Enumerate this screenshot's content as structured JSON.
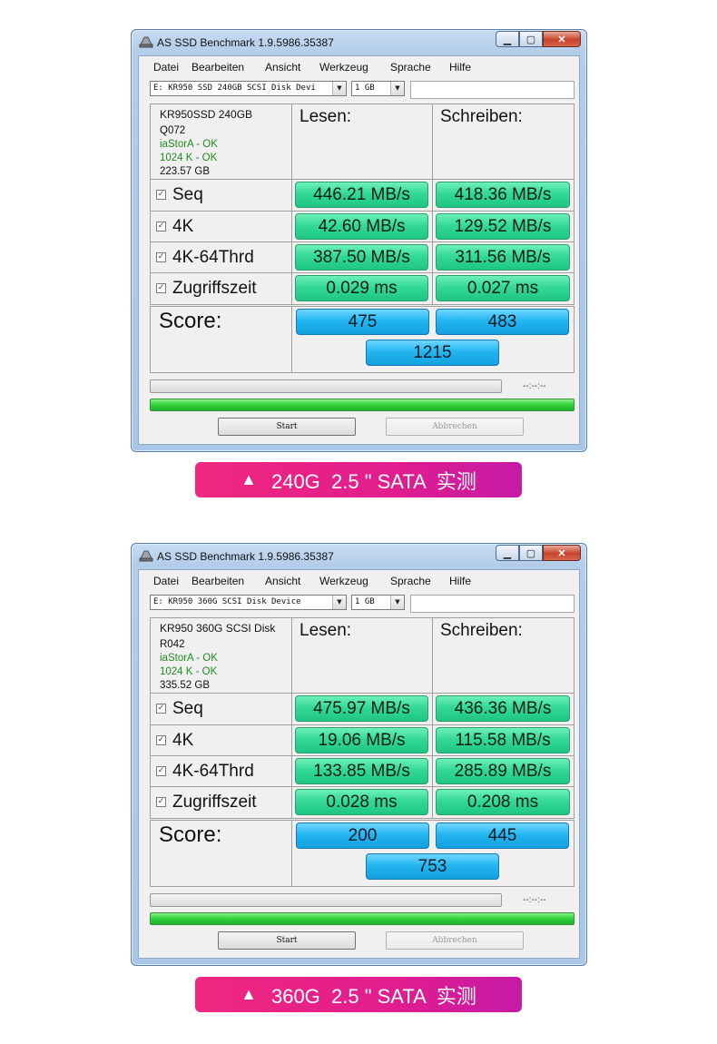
{
  "windows": [
    {
      "title": "AS SSD Benchmark 1.9.5986.35387",
      "menu": [
        "Datei",
        "Bearbeiten",
        "Ansicht",
        "Werkzeug",
        "Sprache",
        "Hilfe"
      ],
      "drive_select": "E: KR950 SSD 240GB SCSI Disk Devi",
      "size_select": "1 GB",
      "drive_info": {
        "model": "KR950SSD 240GB",
        "firmware": "Q072",
        "driver_status": "iaStorA - OK",
        "alignment_status": "1024 K - OK",
        "capacity": "223.57 GB"
      },
      "col_read": "Lesen:",
      "col_write": "Schreiben:",
      "rows": [
        {
          "label": "Seq",
          "checked": true,
          "read": "446.21 MB/s",
          "write": "418.36 MB/s"
        },
        {
          "label": "4K",
          "checked": true,
          "read": "42.60 MB/s",
          "write": "129.52 MB/s"
        },
        {
          "label": "4K-64Thrd",
          "checked": true,
          "read": "387.50 MB/s",
          "write": "311.56 MB/s"
        },
        {
          "label": "Zugriffszeit",
          "checked": true,
          "read": "0.029 ms",
          "write": "0.027 ms"
        }
      ],
      "score_label": "Score:",
      "score_read": "475",
      "score_write": "483",
      "score_total": "1215",
      "timer": "--:--:--",
      "progress_fraction": 0.0,
      "overall_progress_fraction": 1.0,
      "start_label": "Start",
      "abort_label": "Abbrechen"
    },
    {
      "title": "AS SSD Benchmark 1.9.5986.35387",
      "menu": [
        "Datei",
        "Bearbeiten",
        "Ansicht",
        "Werkzeug",
        "Sprache",
        "Hilfe"
      ],
      "drive_select": "E: KR950 360G SCSI Disk Device",
      "size_select": "1 GB",
      "drive_info": {
        "model": "KR950 360G SCSI Disk",
        "firmware": "R042",
        "driver_status": "iaStorA - OK",
        "alignment_status": "1024 K - OK",
        "capacity": "335.52 GB"
      },
      "col_read": "Lesen:",
      "col_write": "Schreiben:",
      "rows": [
        {
          "label": "Seq",
          "checked": true,
          "read": "475.97 MB/s",
          "write": "436.36 MB/s"
        },
        {
          "label": "4K",
          "checked": true,
          "read": "19.06 MB/s",
          "write": "115.58 MB/s"
        },
        {
          "label": "4K-64Thrd",
          "checked": true,
          "read": "133.85 MB/s",
          "write": "285.89 MB/s"
        },
        {
          "label": "Zugriffszeit",
          "checked": true,
          "read": "0.028 ms",
          "write": "0.208 ms"
        }
      ],
      "score_label": "Score:",
      "score_read": "200",
      "score_write": "445",
      "score_total": "753",
      "timer": "--:--:--",
      "progress_fraction": 0.0,
      "overall_progress_fraction": 1.0,
      "start_label": "Start",
      "abort_label": "Abbrechen"
    }
  ],
  "banners": [
    {
      "icon": "triangle-up-icon",
      "text": "240G  2.5 \" SATA  实测"
    },
    {
      "icon": "triangle-up-icon",
      "text": "360G  2.5 \" SATA  实测"
    }
  ],
  "colors": {
    "result_green": "#34d997",
    "score_blue": "#23b6f0",
    "banner_pink": "#e21d8e",
    "ok_text": "#1f8a1f"
  }
}
